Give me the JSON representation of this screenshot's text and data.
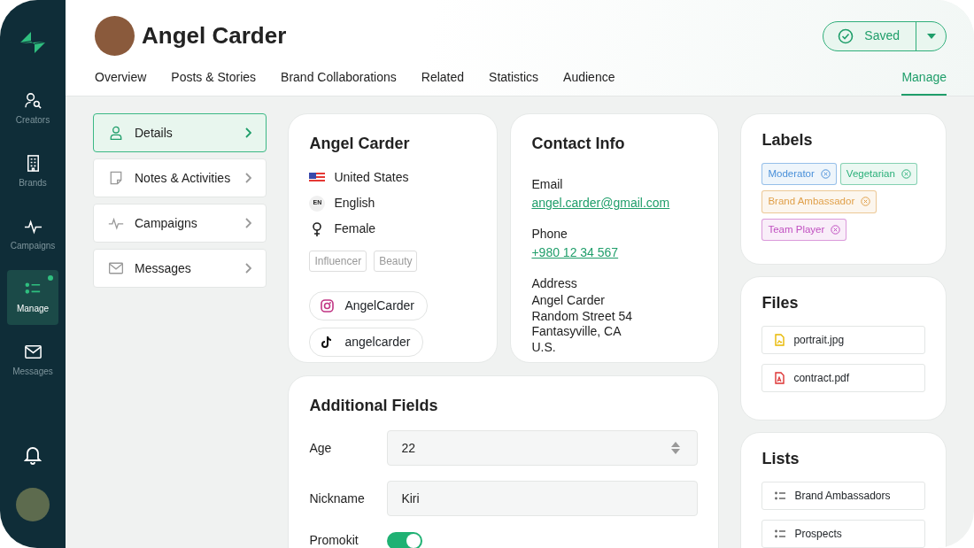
{
  "sidebar": {
    "items": [
      {
        "label": "Creators",
        "kind": "creators",
        "selected": false,
        "dot": false
      },
      {
        "label": "Brands",
        "kind": "brands",
        "selected": false,
        "dot": false
      },
      {
        "label": "Campaigns",
        "kind": "campaigns",
        "selected": false,
        "dot": false
      },
      {
        "label": "Manage",
        "kind": "manage",
        "selected": true,
        "dot": true
      },
      {
        "label": "Messages",
        "kind": "messages",
        "selected": false,
        "dot": false
      }
    ]
  },
  "header": {
    "name": "Angel Carder",
    "save_button": "Saved",
    "tabs": [
      {
        "label": "Overview",
        "selected": false
      },
      {
        "label": "Posts & Stories",
        "selected": false
      },
      {
        "label": "Brand Collaborations",
        "selected": false
      },
      {
        "label": "Related",
        "selected": false
      },
      {
        "label": "Statistics",
        "selected": false
      },
      {
        "label": "Audience",
        "selected": false
      },
      {
        "label": "Manage",
        "selected": true
      }
    ]
  },
  "sections": [
    {
      "label": "Details",
      "kind": "details",
      "selected": true
    },
    {
      "label": "Notes & Activities",
      "kind": "notes",
      "selected": false
    },
    {
      "label": "Campaigns",
      "kind": "campaigns",
      "selected": false
    },
    {
      "label": "Messages",
      "kind": "messages",
      "selected": false
    }
  ],
  "profile": {
    "name": "Angel Carder",
    "facts": [
      {
        "kind": "flag",
        "text": "United States"
      },
      {
        "kind": "language",
        "code": "EN",
        "text": "English"
      },
      {
        "kind": "gender",
        "text": "Female"
      }
    ],
    "tags": [
      "Influencer",
      "Beauty"
    ],
    "socials": [
      {
        "kind": "instagram",
        "handle": "AngelCarder"
      },
      {
        "kind": "tiktok",
        "handle": "angelcarder"
      }
    ]
  },
  "contact": {
    "title": "Contact Info",
    "fields": [
      {
        "label": "Email",
        "kind": "link",
        "value": "angel.carder@gmail.com"
      },
      {
        "label": "Phone",
        "kind": "link",
        "value": "+980 12 34 567"
      },
      {
        "label": "Address",
        "kind": "lines",
        "lines": [
          "Angel Carder",
          "Random Street 54",
          "Fantasyville, CA",
          "U.S."
        ]
      }
    ]
  },
  "additional_fields": {
    "title": "Additional Fields",
    "rows": [
      {
        "kind": "number",
        "label": "Age",
        "value": "22"
      },
      {
        "kind": "text",
        "label": "Nickname",
        "value": "Kiri"
      },
      {
        "kind": "toggle",
        "label": "Promokit",
        "on": true
      }
    ]
  },
  "labels": {
    "title": "Labels",
    "items": [
      {
        "text": "Moderator",
        "color": "#4a90d9"
      },
      {
        "text": "Vegetarian",
        "color": "#2bb07a"
      },
      {
        "text": "Brand Ambassador",
        "color": "#e0a04a"
      },
      {
        "text": "Team Player",
        "color": "#c04fc0"
      }
    ]
  },
  "files": {
    "title": "Files",
    "items": [
      {
        "kind": "image",
        "name": "portrait.jpg"
      },
      {
        "kind": "pdf",
        "name": "contract.pdf"
      }
    ]
  },
  "lists": {
    "title": "Lists",
    "items": [
      "Brand Ambassadors",
      "Prospects"
    ]
  }
}
